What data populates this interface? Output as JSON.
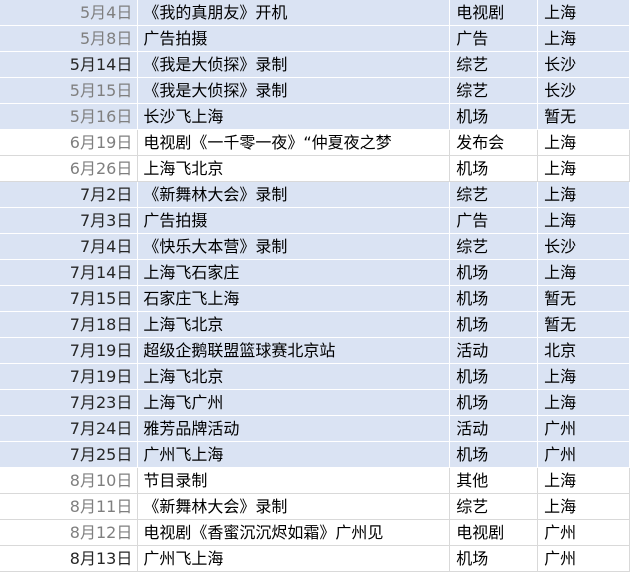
{
  "schedule": {
    "rows": [
      {
        "date": "5月4日",
        "event": "《我的真朋友》开机",
        "type": "电视剧",
        "city": "上海",
        "highlight": true,
        "date_muted": true
      },
      {
        "date": "5月8日",
        "event": "广告拍摄",
        "type": "广告",
        "city": "上海",
        "highlight": true,
        "date_muted": true
      },
      {
        "date": "5月14日",
        "event": "《我是大侦探》录制",
        "type": "综艺",
        "city": "长沙",
        "highlight": true,
        "date_muted": false
      },
      {
        "date": "5月15日",
        "event": "《我是大侦探》录制",
        "type": "综艺",
        "city": "长沙",
        "highlight": true,
        "date_muted": true
      },
      {
        "date": "5月16日",
        "event": "长沙飞上海",
        "type": "机场",
        "city": "暂无",
        "highlight": true,
        "date_muted": true
      },
      {
        "date": "6月19日",
        "event": "电视剧《一千零一夜》“仲夏夜之梦",
        "type": "发布会",
        "city": "上海",
        "highlight": false,
        "date_muted": true
      },
      {
        "date": "6月26日",
        "event": "上海飞北京",
        "type": "机场",
        "city": "上海",
        "highlight": false,
        "date_muted": true
      },
      {
        "date": "7月2日",
        "event": "《新舞林大会》录制",
        "type": "综艺",
        "city": "上海",
        "highlight": true,
        "date_muted": false
      },
      {
        "date": "7月3日",
        "event": "广告拍摄",
        "type": "广告",
        "city": "上海",
        "highlight": true,
        "date_muted": false
      },
      {
        "date": "7月4日",
        "event": "《快乐大本营》录制",
        "type": "综艺",
        "city": "长沙",
        "highlight": true,
        "date_muted": false
      },
      {
        "date": "7月14日",
        "event": "上海飞石家庄",
        "type": "机场",
        "city": "上海",
        "highlight": true,
        "date_muted": false
      },
      {
        "date": "7月15日",
        "event": "石家庄飞上海",
        "type": "机场",
        "city": "暂无",
        "highlight": true,
        "date_muted": false
      },
      {
        "date": "7月18日",
        "event": "上海飞北京",
        "type": "机场",
        "city": "暂无",
        "highlight": true,
        "date_muted": false
      },
      {
        "date": "7月19日",
        "event": "超级企鹅联盟篮球赛北京站",
        "type": "活动",
        "city": "北京",
        "highlight": true,
        "date_muted": false
      },
      {
        "date": "7月19日",
        "event": "上海飞北京",
        "type": "机场",
        "city": "上海",
        "highlight": true,
        "date_muted": false
      },
      {
        "date": "7月23日",
        "event": "上海飞广州",
        "type": "机场",
        "city": "上海",
        "highlight": true,
        "date_muted": false
      },
      {
        "date": "7月24日",
        "event": "雅芳品牌活动",
        "type": "活动",
        "city": "广州",
        "highlight": true,
        "date_muted": false
      },
      {
        "date": "7月25日",
        "event": "广州飞上海",
        "type": "机场",
        "city": "广州",
        "highlight": true,
        "date_muted": false
      },
      {
        "date": "8月10日",
        "event": "节目录制",
        "type": "其他",
        "city": "上海",
        "highlight": false,
        "date_muted": true
      },
      {
        "date": "8月11日",
        "event": "《新舞林大会》录制",
        "type": "综艺",
        "city": "上海",
        "highlight": false,
        "date_muted": true
      },
      {
        "date": "8月12日",
        "event": "电视剧《香蜜沉沉烬如霜》广州见",
        "type": "电视剧",
        "city": "广州",
        "highlight": false,
        "date_muted": true
      },
      {
        "date": "8月13日",
        "event": "广州飞上海",
        "type": "机场",
        "city": "广州",
        "highlight": false,
        "date_muted": false
      }
    ]
  }
}
